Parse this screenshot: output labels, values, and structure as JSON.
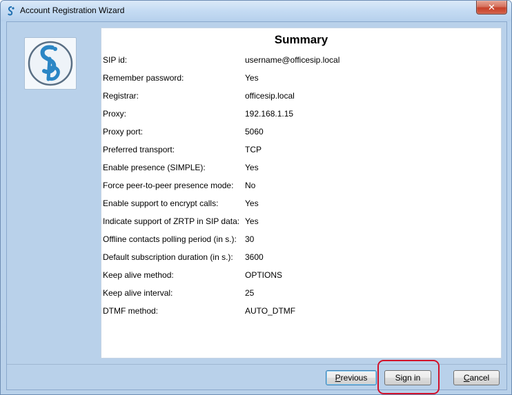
{
  "window": {
    "title": "Account Registration Wizard",
    "close_label": "✕"
  },
  "summary": {
    "title": "Summary",
    "rows": [
      {
        "label": "SIP id:",
        "value": "username@officesip.local"
      },
      {
        "label": "Remember password:",
        "value": "Yes"
      },
      {
        "label": "Registrar:",
        "value": "officesip.local"
      },
      {
        "label": "Proxy:",
        "value": "192.168.1.15"
      },
      {
        "label": "Proxy port:",
        "value": "5060"
      },
      {
        "label": "Preferred transport:",
        "value": "TCP"
      },
      {
        "label": "Enable presence (SIMPLE):",
        "value": "Yes"
      },
      {
        "label": "Force peer-to-peer presence mode:",
        "value": "No"
      },
      {
        "label": "Enable support to encrypt calls:",
        "value": "Yes"
      },
      {
        "label": "Indicate support of ZRTP in SIP data:",
        "value": "Yes"
      },
      {
        "label": "Offline contacts polling period (in s.):",
        "value": "30"
      },
      {
        "label": "Default subscription duration (in s.):",
        "value": "3600"
      },
      {
        "label": "Keep alive method:",
        "value": "OPTIONS"
      },
      {
        "label": "Keep alive interval:",
        "value": "25"
      },
      {
        "label": "DTMF method:",
        "value": "AUTO_DTMF"
      }
    ]
  },
  "buttons": {
    "previous": "Previous",
    "sign_in": "Sign in",
    "cancel": "Cancel"
  },
  "colors": {
    "highlight_ring": "#d2102a",
    "logo_blue": "#2b86c5"
  },
  "icons": {
    "app": "sip-logo-icon",
    "title": "app-title-icon"
  }
}
